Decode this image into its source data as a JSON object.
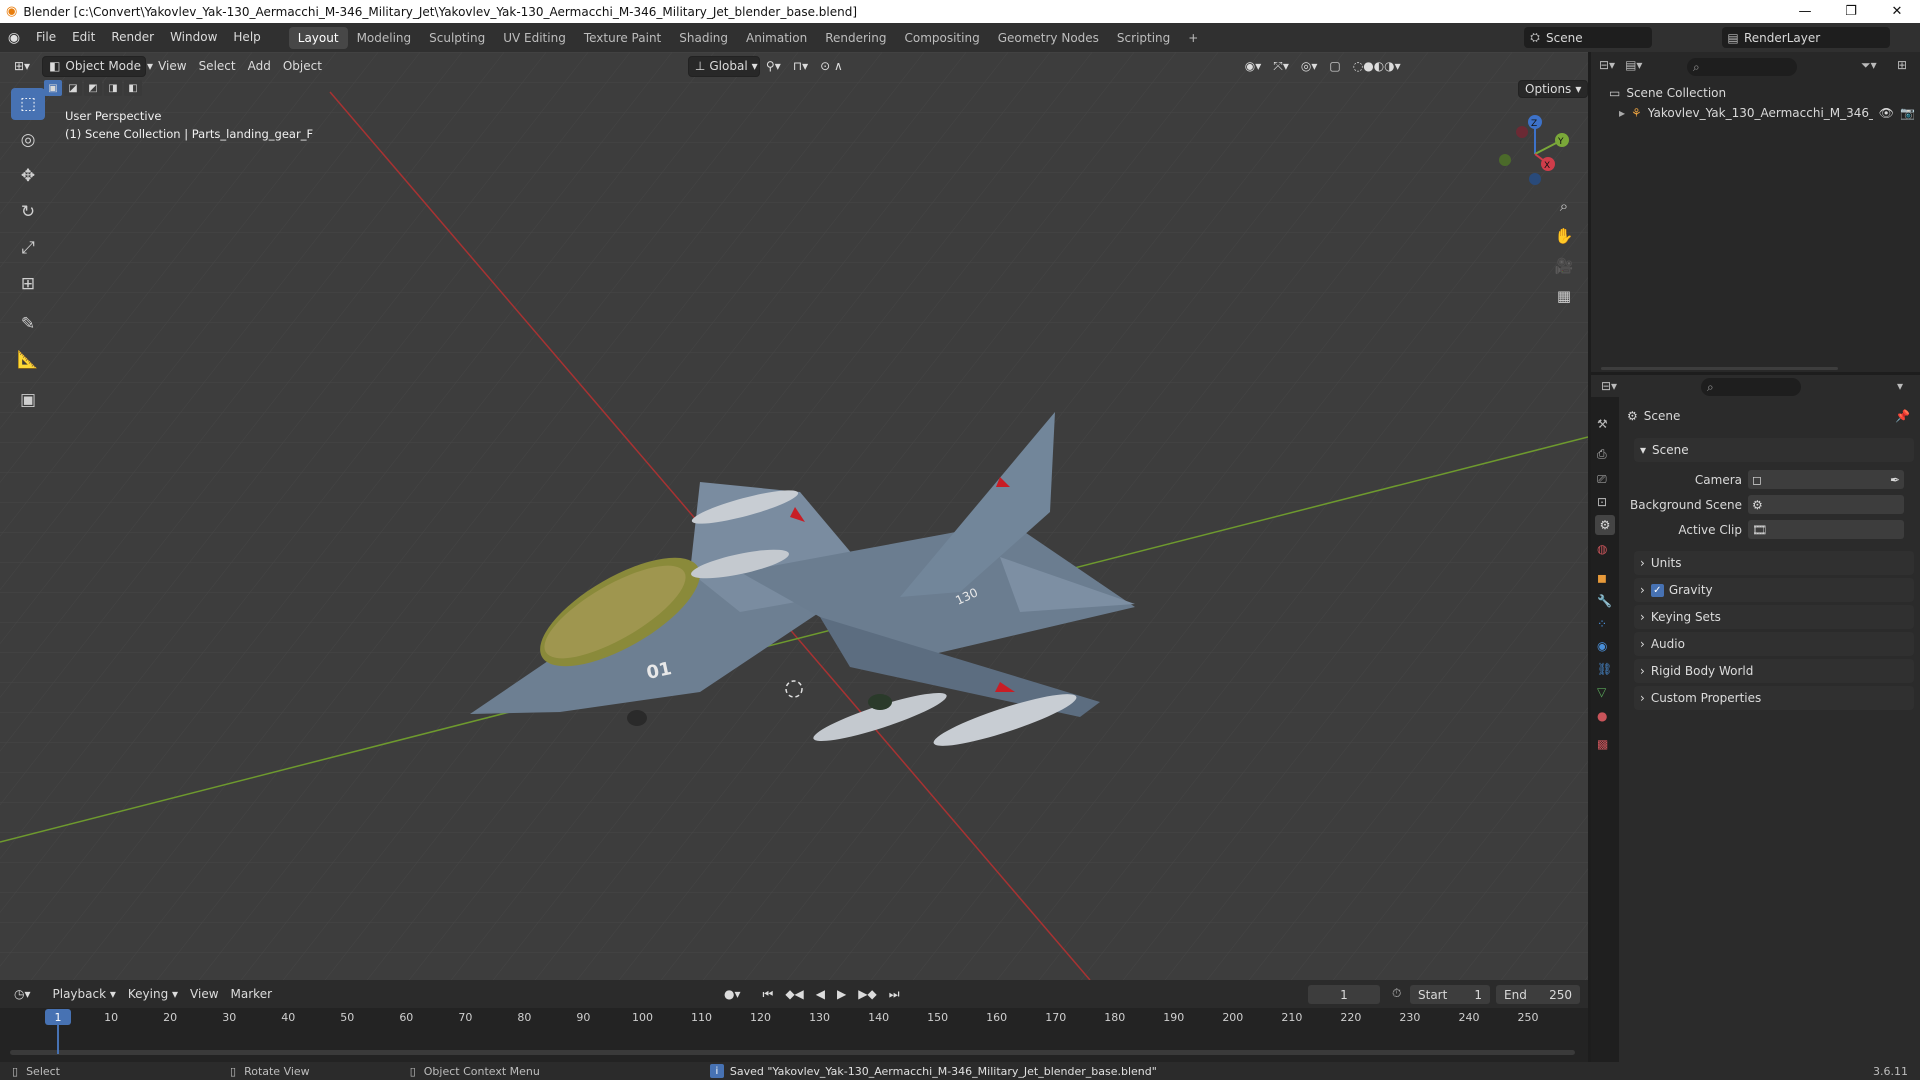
{
  "window": {
    "title": "Blender [c:\\Convert\\Yakovlev_Yak-130_Aermacchi_M-346_Military_Jet\\Yakovlev_Yak-130_Aermacchi_M-346_Military_Jet_blender_base.blend]",
    "minimize": "—",
    "maximize": "❐",
    "close": "✕"
  },
  "menu": [
    "File",
    "Edit",
    "Render",
    "Window",
    "Help"
  ],
  "workspaces": [
    "Layout",
    "Modeling",
    "Sculpting",
    "UV Editing",
    "Texture Paint",
    "Shading",
    "Animation",
    "Rendering",
    "Compositing",
    "Geometry Nodes",
    "Scripting"
  ],
  "workspace_add": "+",
  "scene_field": "Scene",
  "renderlayer_field": "RenderLayer",
  "viewport_header": {
    "mode": "Object Mode",
    "menus": [
      "View",
      "Select",
      "Add",
      "Object"
    ],
    "orientation": "Global",
    "options": "Options"
  },
  "viewport_overlay": {
    "perspective": "User Perspective",
    "collection": "(1) Scene Collection | Parts_landing_gear_F"
  },
  "gizmo": {
    "x": "X",
    "y": "Y",
    "z": "Z"
  },
  "outliner": {
    "root": "Scene Collection",
    "items": [
      {
        "label": "Yakovlev_Yak_130_Aermacchi_M_346_"
      }
    ]
  },
  "properties": {
    "header": "Scene",
    "panel": "Scene",
    "camera_label": "Camera",
    "background_label": "Background Scene",
    "clip_label": "Active Clip",
    "sections": [
      "Units",
      "Gravity",
      "Keying Sets",
      "Audio",
      "Rigid Body World",
      "Custom Properties"
    ],
    "gravity_checked": true
  },
  "model_markings": {
    "nose_number": "01",
    "tail_number": "130"
  },
  "timeline": {
    "menus": [
      "Playback",
      "Keying",
      "View",
      "Marker"
    ],
    "current_frame": "1",
    "start_label": "Start",
    "start_value": "1",
    "end_label": "End",
    "end_value": "250",
    "ticks": [
      "1",
      "10",
      "20",
      "30",
      "40",
      "50",
      "60",
      "70",
      "80",
      "90",
      "100",
      "110",
      "120",
      "130",
      "140",
      "150",
      "160",
      "170",
      "180",
      "190",
      "200",
      "210",
      "220",
      "230",
      "240",
      "250"
    ]
  },
  "statusbar": {
    "select": "Select",
    "rotate": "Rotate View",
    "context": "Object Context Menu",
    "message": "Saved \"Yakovlev_Yak-130_Aermacchi_M-346_Military_Jet_blender_base.blend\"",
    "version": "3.6.11"
  },
  "colors": {
    "accent": "#4772b3",
    "viewport_bg": "#3d3d3d",
    "x_axis": "#c23b3b",
    "y_axis": "#6e9a2e"
  }
}
